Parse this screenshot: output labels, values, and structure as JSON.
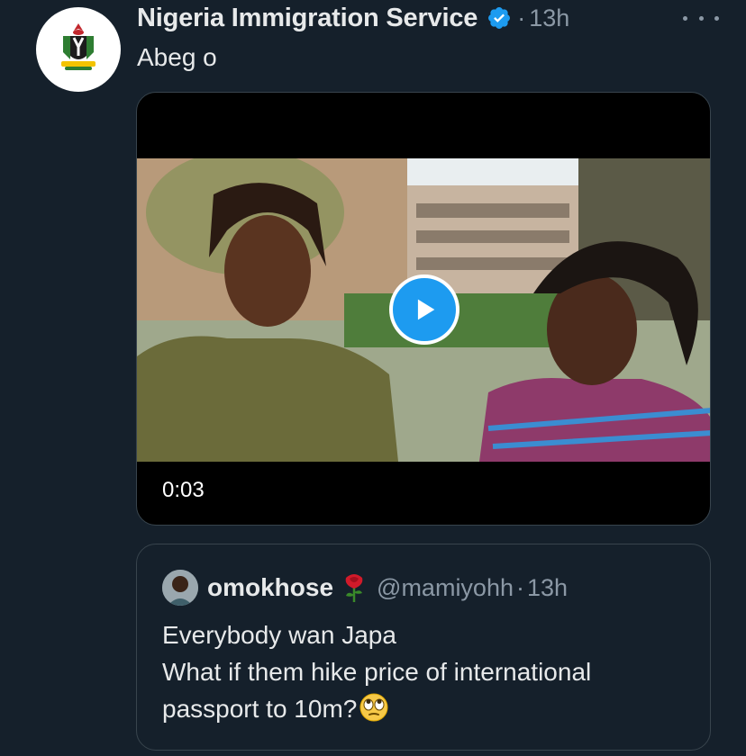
{
  "tweet": {
    "author_name": "Nigeria Immigration Service",
    "separator": "·",
    "time": "13h",
    "text": "Abeg o",
    "video": {
      "duration": "0:03"
    }
  },
  "quote": {
    "author_name": "omokhose",
    "handle": "@mamiyohh",
    "separator": "·",
    "time": "13h",
    "lines": [
      "Everybody wan Japa",
      "What if them hike price of international",
      "passport to 10m?"
    ],
    "name_emoji": "rose",
    "end_emoji": "face-with-rolling-eyes"
  },
  "colors": {
    "background": "#15202b",
    "primary_text": "#e7e9ea",
    "secondary_text": "#8b98a5",
    "accent": "#1d9bf0",
    "border": "#38444d"
  },
  "icons": [
    "verified-badge-icon",
    "more-icon",
    "play-icon",
    "rose-emoji-icon",
    "rolling-eyes-emoji-icon"
  ]
}
